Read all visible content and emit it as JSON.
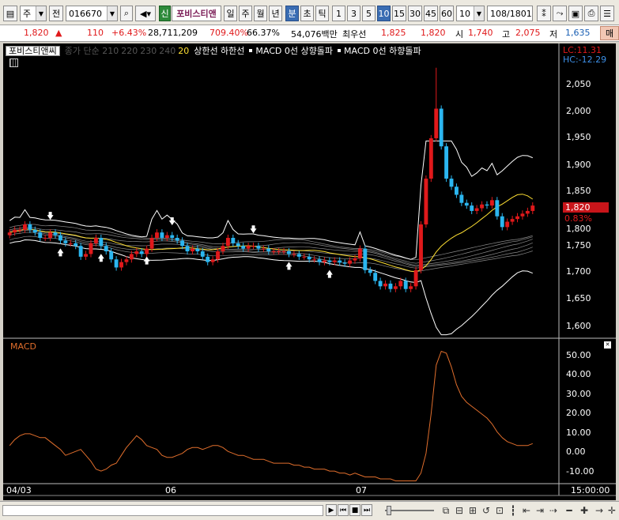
{
  "toolbar": {
    "market": "주",
    "jeon": "전",
    "code": "016670",
    "shin": "신",
    "stock_name": "포비스티앤",
    "periods": [
      "일",
      "주",
      "월",
      "년",
      "분",
      "초",
      "틱"
    ],
    "minutes": [
      "1",
      "3",
      "5",
      "10",
      "15",
      "30",
      "45",
      "60"
    ],
    "interval_value": "10",
    "counter": "108",
    "counter_total": "/1801"
  },
  "pricebar": {
    "price": "1,820",
    "change_arrow": "▲",
    "change": "110",
    "change_pct": "+6.43%",
    "volume": "28,711,209",
    "volume_ratio": "709.40%",
    "turnover": "66.37%",
    "amount": "54,076백만",
    "best_bid_label": "최우선",
    "best_ask": "1,825",
    "best_bid": "1,820",
    "open_label": "시",
    "open": "1,740",
    "high_label": "고",
    "high": "2,075",
    "low_label": "저",
    "low": "1,635",
    "mode": "매"
  },
  "legend": {
    "name": "포비스티앤씨",
    "dim": [
      "종가 단순 210",
      "220",
      "230",
      "240"
    ],
    "ma20": "20",
    "limit": "상한선  하한선",
    "macd_up": "MACD 0선 상향돌파",
    "macd_down": "MACD 0선 하향돌파"
  },
  "overlay": {
    "lc": "LC:11.31",
    "hc": "HC:-12.29",
    "price_tag": "1,820",
    "pct_tag": "0.83%",
    "macd_label": "MACD"
  },
  "axes": {
    "price_ticks": [
      "2,050",
      "2,000",
      "1,950",
      "1,900",
      "1,850",
      "1,800",
      "1,750",
      "1,700",
      "1,650",
      "1,600"
    ],
    "macd_ticks": [
      "50.00",
      "40.00",
      "30.00",
      "20.00",
      "10.00",
      "0.00",
      "-10.00"
    ],
    "dates": [
      "04/03",
      "06",
      "07"
    ],
    "time": "15:00:00"
  },
  "colors": {
    "up": "#e0191b",
    "down": "#2bb6f0",
    "ma20": "#ffe033",
    "macd": "#e06e2c",
    "band": "#ffffff"
  },
  "chart_data": {
    "type": "line",
    "title": "",
    "price_ylim": [
      1575,
      2080
    ],
    "close": [
      1770,
      1775,
      1775,
      1785,
      1775,
      1770,
      1760,
      1760,
      1770,
      1765,
      1755,
      1750,
      1750,
      1745,
      1725,
      1730,
      1750,
      1760,
      1745,
      1735,
      1720,
      1705,
      1715,
      1720,
      1730,
      1735,
      1730,
      1740,
      1760,
      1770,
      1760,
      1765,
      1760,
      1755,
      1745,
      1735,
      1740,
      1735,
      1725,
      1715,
      1720,
      1735,
      1745,
      1760,
      1750,
      1745,
      1740,
      1745,
      1745,
      1740,
      1740,
      1735,
      1735,
      1735,
      1735,
      1730,
      1730,
      1725,
      1725,
      1720,
      1720,
      1715,
      1718,
      1715,
      1718,
      1714,
      1712,
      1718,
      1722,
      1740,
      1700,
      1695,
      1680,
      1670,
      1675,
      1665,
      1670,
      1680,
      1665,
      1670,
      1700,
      1785,
      1870,
      1945,
      2000,
      1930,
      1870,
      1855,
      1840,
      1825,
      1820,
      1810,
      1815,
      1822,
      1820,
      1830,
      1800,
      1780,
      1790,
      1795,
      1800,
      1805,
      1810,
      1820
    ],
    "macd_ylim": [
      -15,
      55
    ],
    "macd": [
      4,
      7,
      9,
      10,
      10,
      9,
      8,
      8,
      6,
      4,
      2,
      -1,
      0,
      1,
      2,
      -1,
      -4,
      -8,
      -9,
      -8,
      -6,
      -5,
      -1,
      3,
      6,
      9,
      7,
      4,
      3,
      2,
      -1,
      -2,
      -2,
      -1,
      0,
      2,
      3,
      3,
      2,
      3,
      4,
      4,
      3,
      1,
      0,
      -1,
      -1,
      -2,
      -3,
      -3,
      -3,
      -4,
      -5,
      -5,
      -5,
      -5,
      -6,
      -6,
      -7,
      -7,
      -8,
      -8,
      -8,
      -9,
      -9,
      -10,
      -10,
      -11,
      -10,
      -11,
      -12,
      -12,
      -12,
      -13,
      -13,
      -13,
      -14,
      -14,
      -14,
      -14,
      -14,
      -10,
      0,
      20,
      45,
      52,
      51,
      44,
      35,
      29,
      26,
      24,
      22,
      20,
      18,
      15,
      11,
      8,
      6,
      5,
      4,
      4,
      4,
      5
    ],
    "macd_zero_up_markers": [
      10,
      18,
      27,
      55,
      63
    ],
    "macd_zero_down_markers": [
      8,
      32,
      48
    ]
  }
}
